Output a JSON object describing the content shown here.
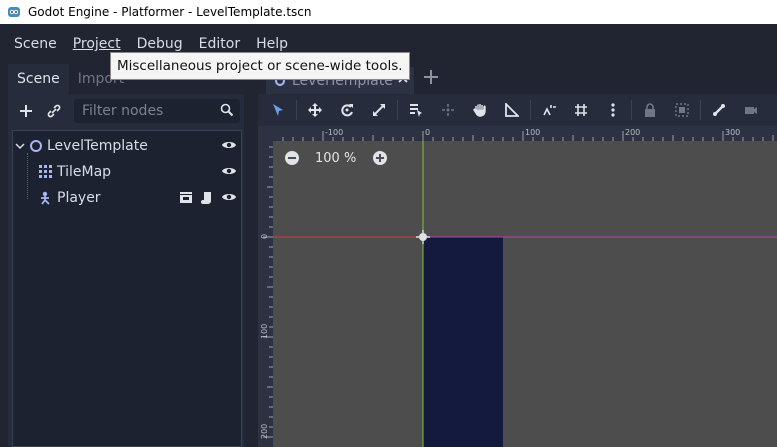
{
  "window": {
    "title": "Godot Engine - Platformer - LevelTemplate.tscn"
  },
  "menu": {
    "items": [
      {
        "label": "Scene"
      },
      {
        "label": "Project"
      },
      {
        "label": "Debug"
      },
      {
        "label": "Editor"
      },
      {
        "label": "Help"
      }
    ],
    "tooltip": "Miscellaneous project or scene-wide tools."
  },
  "dock": {
    "tabs": [
      {
        "label": "Scene"
      },
      {
        "label": "Import"
      }
    ],
    "filter_placeholder": "Filter nodes",
    "nodes": [
      {
        "label": "LevelTemplate",
        "icon": "node2d-icon"
      },
      {
        "label": "TileMap",
        "icon": "tilemap-icon"
      },
      {
        "label": "Player",
        "icon": "kinematic-body-icon"
      }
    ]
  },
  "editor": {
    "scene_tab": "LevelTemplate",
    "zoom": "100 %",
    "ruler_top": [
      "-100",
      "0",
      "100",
      "200",
      "300"
    ],
    "ruler_left": [
      "0",
      "100",
      "200"
    ]
  },
  "colors": {
    "accent": "#699ce8",
    "x_axis": "#d33a3a",
    "y_axis": "#87c43a",
    "tile_block": "#141a3d"
  }
}
